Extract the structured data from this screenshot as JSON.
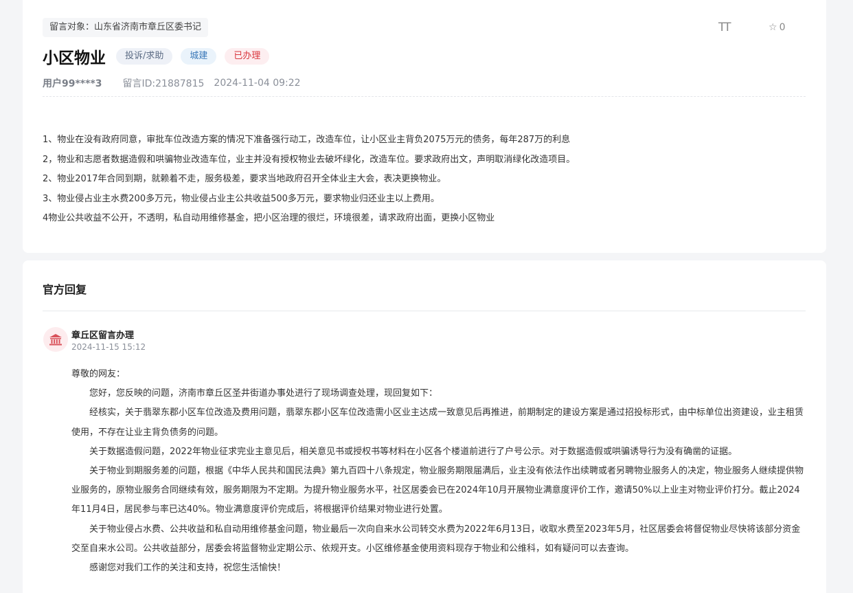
{
  "message": {
    "target_label": "留言对象：山东省济南市章丘区委书记",
    "title": "小区物业",
    "tags": {
      "type": "投诉/求助",
      "category": "城建",
      "status": "已办理"
    },
    "user": "用户99****3",
    "message_id": "留言ID:21887815",
    "datetime": "2024-11-04 09:22",
    "font_toggle_icon": "text-size-icon",
    "font_toggle_glyph": "TT",
    "favorite_icon": "star-outline-icon",
    "favorite_count": "0",
    "content": [
      "1、物业在没有政府同意，审批车位改造方案的情况下准备强行动工，改造车位，让小区业主背负2075万元的债务，每年287万的利息",
      "2，物业和志愿者数据造假和哄骗物业改造车位，业主并没有授权物业去破坏绿化，改造车位。要求政府出文，声明取消绿化改造项目。",
      "2、物业2017年合同到期，就赖着不走，服务极差，要求当地政府召开全体业主大会，表决更换物业。",
      "3、物业侵占业主水费200多万元，物业侵占业主公共收益500多万元，要求物业归还业主以上费用。",
      "4物业公共收益不公开，不透明，私自动用维修基金，把小区治理的很烂，环境很差，请求政府出面，更换小区物业"
    ]
  },
  "reply": {
    "heading": "官方回复",
    "avatar_icon": "government-building-icon",
    "org_name": "章丘区留言办理",
    "datetime": "2024-11-15 15:12",
    "salutation": "尊敬的网友：",
    "paragraphs": [
      "您好，您反映的问题，济南市章丘区圣井街道办事处进行了现场调查处理，现回复如下：",
      "经核实，关于翡翠东郡小区车位改造及费用问题，翡翠东郡小区车位改造需小区业主达成一致意见后再推进，前期制定的建设方案是通过招投标形式，由中标单位出资建设，业主租赁使用，不存在让业主背负债务的问题。",
      "关于数据造假问题，2022年物业征求完业主意见后，相关意见书或授权书等材料在小区各个楼道前进行了户号公示。对于数据造假或哄骗诱导行为没有确凿的证据。",
      "关于物业到期服务差的问题，根据《中华人民共和国民法典》第九百四十八条规定，物业服务期限届满后，业主没有依法作出续聘或者另聘物业服务人的决定，物业服务人继续提供物业服务的，原物业服务合同继续有效，服务期限为不定期。为提升物业服务水平，社区居委会已在2024年10月开展物业满意度评价工作，邀请50%以上业主对物业评价打分。截止2024年11月4日，居民参与率已达40%。物业满意度评价完成后，将根据评价结果对物业进行处置。",
      "关于物业侵占水费、公共收益和私自动用维修基金问题，物业最后一次向自来水公司转交水费为2022年6月13日，收取水费至2023年5月，社区居委会将督促物业尽快将该部分资金交至自来水公司。公共收益部分，居委会将监督物业定期公示、依规开支。小区维修基金使用资料现存于物业和公维科，如有疑问可以去查询。",
      "感谢您对我们工作的关注和支持，祝您生活愉快！"
    ]
  },
  "colors": {
    "page_bg": "#f4f5f7",
    "status_red": "#d9363e",
    "category_blue": "#3a78b8",
    "avatar_red": "#d9525b"
  }
}
